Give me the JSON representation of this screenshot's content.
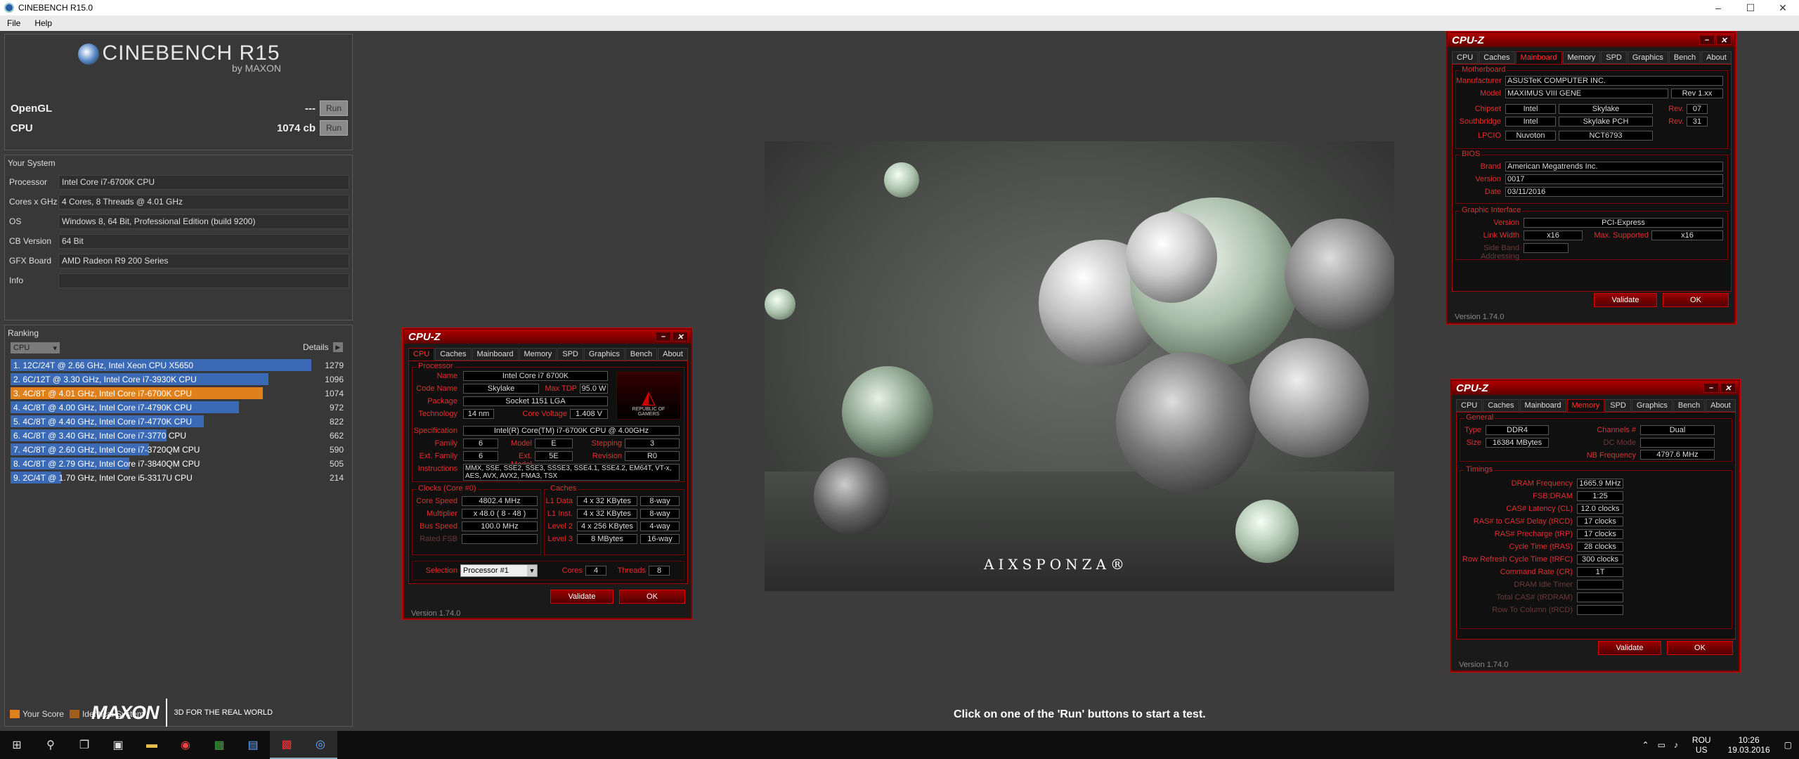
{
  "window": {
    "title": "CINEBENCH R15.0",
    "min": "–",
    "max": "☐",
    "close": "✕"
  },
  "menu": [
    "File",
    "Help"
  ],
  "logo": {
    "name": "CINEBENCH R15",
    "sub": "by MAXON"
  },
  "tests": [
    {
      "label": "OpenGL",
      "score": "---",
      "button": "Run"
    },
    {
      "label": "CPU",
      "score": "1074 cb",
      "button": "Run"
    }
  ],
  "system": {
    "heading": "Your System",
    "rows": [
      {
        "key": "Processor",
        "value": "Intel Core i7-6700K CPU"
      },
      {
        "key": "Cores x GHz",
        "value": "4 Cores, 8 Threads @ 4.01 GHz"
      },
      {
        "key": "OS",
        "value": "Windows 8, 64 Bit, Professional Edition (build 9200)"
      },
      {
        "key": "CB Version",
        "value": "64 Bit"
      },
      {
        "key": "GFX Board",
        "value": "AMD Radeon R9 200 Series"
      },
      {
        "key": "Info",
        "value": ""
      }
    ]
  },
  "ranking": {
    "heading": "Ranking",
    "select": "CPU",
    "details": "Details",
    "max_score": 1279,
    "items": [
      {
        "label": "1. 12C/24T @ 2.66 GHz, Intel Xeon CPU X5650",
        "score": 1279,
        "color": "#3a6ab5"
      },
      {
        "label": "2. 6C/12T @ 3.30 GHz,  Intel Core i7-3930K CPU",
        "score": 1096,
        "color": "#3a6ab5"
      },
      {
        "label": "3. 4C/8T @ 4.01 GHz, Intel Core i7-6700K CPU",
        "score": 1074,
        "color": "#e0801a"
      },
      {
        "label": "4. 4C/8T @ 4.00 GHz, Intel Core i7-4790K CPU",
        "score": 972,
        "color": "#3a6ab5"
      },
      {
        "label": "5. 4C/8T @ 4.40 GHz, Intel Core i7-4770K CPU",
        "score": 822,
        "color": "#3a6ab5"
      },
      {
        "label": "6. 4C/8T @ 3.40 GHz,  Intel Core i7-3770 CPU",
        "score": 662,
        "color": "#3a6ab5"
      },
      {
        "label": "7. 4C/8T @ 2.60 GHz, Intel Core i7-3720QM CPU",
        "score": 590,
        "color": "#3a6ab5"
      },
      {
        "label": "8. 4C/8T @ 2.79 GHz,  Intel Core i7-3840QM CPU",
        "score": 505,
        "color": "#3a6ab5"
      },
      {
        "label": "9. 2C/4T @ 1.70 GHz,  Intel Core i5-3317U CPU",
        "score": 214,
        "color": "#3a6ab5"
      }
    ]
  },
  "legend": [
    {
      "label": "Your Score",
      "color": "#e0801a"
    },
    {
      "label": "Identical System",
      "color": "#a0601a"
    }
  ],
  "maxon": {
    "name": "MAXON",
    "tagline": "3D FOR THE REAL WORLD"
  },
  "render_brand": "AIXSPONZA®",
  "status": "Click on one of the 'Run' buttons to start a test.",
  "tabs_all": [
    "CPU",
    "Caches",
    "Mainboard",
    "Memory",
    "SPD",
    "Graphics",
    "Bench",
    "About"
  ],
  "cpuz_cpu": {
    "title": "CPU-Z",
    "version": "Version 1.74.0",
    "validate": "Validate",
    "ok": "OK",
    "processor": {
      "heading": "Processor",
      "name": "Intel Core i7 6700K",
      "codename": "Skylake",
      "maxtdp": "95.0 W",
      "package": "Socket 1151 LGA",
      "technology": "14 nm",
      "corevoltage": "1.408 V",
      "spec": "Intel(R) Core(TM) i7-6700K CPU @ 4.00GHz",
      "family": "6",
      "model": "E",
      "stepping": "3",
      "extfamily": "6",
      "extmodel": "5E",
      "revision": "R0",
      "instructions": "MMX, SSE, SSE2, SSE3, SSSE3, SSE4.1, SSE4.2, EM64T, VT-x, AES, AVX, AVX2, FMA3, TSX"
    },
    "labels": {
      "name": "Name",
      "codename": "Code Name",
      "maxtdp": "Max TDP",
      "package": "Package",
      "technology": "Technology",
      "corevoltage": "Core Voltage",
      "spec": "Specification",
      "family": "Family",
      "model": "Model",
      "stepping": "Stepping",
      "extfamily": "Ext. Family",
      "extmodel": "Ext. Model",
      "revision": "Revision",
      "instructions": "Instructions",
      "clocks": "Clocks (Core #0)",
      "corespeed": "Core Speed",
      "multiplier": "Multiplier",
      "busspeed": "Bus Speed",
      "ratedfsb": "Rated FSB",
      "caches": "Caches",
      "l1d": "L1 Data",
      "l1i": "L1 Inst.",
      "l2": "Level 2",
      "l3": "Level 3",
      "selection": "Selection",
      "cores": "Cores",
      "threads": "Threads",
      "rog1": "REPUBLIC OF",
      "rog2": "GAMERS"
    },
    "clocks": {
      "corespeed": "4802.4 MHz",
      "multiplier": "x 48.0 ( 8 - 48 )",
      "busspeed": "100.0 MHz",
      "ratedfsb": ""
    },
    "caches": {
      "l1d": "4 x 32 KBytes",
      "l1d_way": "8-way",
      "l1i": "4 x 32 KBytes",
      "l1i_way": "8-way",
      "l2": "4 x 256 KBytes",
      "l2_way": "4-way",
      "l3": "8 MBytes",
      "l3_way": "16-way"
    },
    "selection": "Processor #1",
    "cores": "4",
    "threads": "8"
  },
  "cpuz_mb": {
    "title": "CPU-Z",
    "version": "Version 1.74.0",
    "validate": "Validate",
    "ok": "OK",
    "labels": {
      "motherboard": "Motherboard",
      "manufacturer": "Manufacturer",
      "model": "Model",
      "chipset": "Chipset",
      "southbridge": "Southbridge",
      "lpcio": "LPCIO",
      "rev": "Rev.",
      "bios": "BIOS",
      "brand": "Brand",
      "version": "Version",
      "date": "Date",
      "graphic": "Graphic Interface",
      "gversion": "Version",
      "linkwidth": "Link Width",
      "maxsupported": "Max. Supported",
      "sideband": "Side Band Addressing"
    },
    "manufacturer": "ASUSTeK COMPUTER INC.",
    "model": "MAXIMUS VIII GENE",
    "model_rev": "Rev 1.xx",
    "chipset_vendor": "Intel",
    "chipset": "Skylake",
    "chipset_rev": "07",
    "sb_vendor": "Intel",
    "sb": "Skylake PCH",
    "sb_rev": "31",
    "lpcio_vendor": "Nuvoton",
    "lpcio": "NCT6793",
    "bios_brand": "American Megatrends Inc.",
    "bios_version": "0017",
    "bios_date": "03/11/2016",
    "g_version": "PCI-Express",
    "g_linkwidth": "x16",
    "g_max": "x16",
    "g_sideband": ""
  },
  "cpuz_mem": {
    "title": "CPU-Z",
    "version": "Version 1.74.0",
    "validate": "Validate",
    "ok": "OK",
    "labels": {
      "general": "General",
      "type": "Type",
      "size": "Size",
      "channels": "Channels #",
      "dcmode": "DC Mode",
      "nbfreq": "NB Frequency",
      "timings": "Timings",
      "dramfreq": "DRAM Frequency",
      "fsbdram": "FSB:DRAM",
      "cas": "CAS# Latency (CL)",
      "rcd": "RAS# to CAS# Delay (tRCD)",
      "rp": "RAS# Precharge (tRP)",
      "ras": "Cycle Time (tRAS)",
      "rfc": "Row Refresh Cycle Time (tRFC)",
      "cr": "Command Rate (CR)",
      "idle": "DRAM Idle Timer",
      "rdram": "Total CAS# (tRDRAM)",
      "rtc": "Row To Column (tRCD)"
    },
    "type": "DDR4",
    "size": "16384 MBytes",
    "channels": "Dual",
    "dcmode": "",
    "nbfreq": "4797.6 MHz",
    "dramfreq": "1665.9 MHz",
    "fsbdram": "1:25",
    "cas": "12.0 clocks",
    "rcd": "17 clocks",
    "rp": "17 clocks",
    "ras": "28 clocks",
    "rfc": "300 clocks",
    "cr": "1T",
    "idle": "",
    "rdram": "",
    "rtc": ""
  },
  "tray": {
    "lang1": "ROU",
    "lang2": "US",
    "time": "10:26",
    "date": "19.03.2016"
  },
  "taskbar": [
    "start-icon",
    "search-icon",
    "task-view-icon",
    "store-icon",
    "file-explorer-icon",
    "chrome-icon",
    "app-icon",
    "notes-icon",
    "cpuz-icon",
    "cinebench-icon"
  ]
}
